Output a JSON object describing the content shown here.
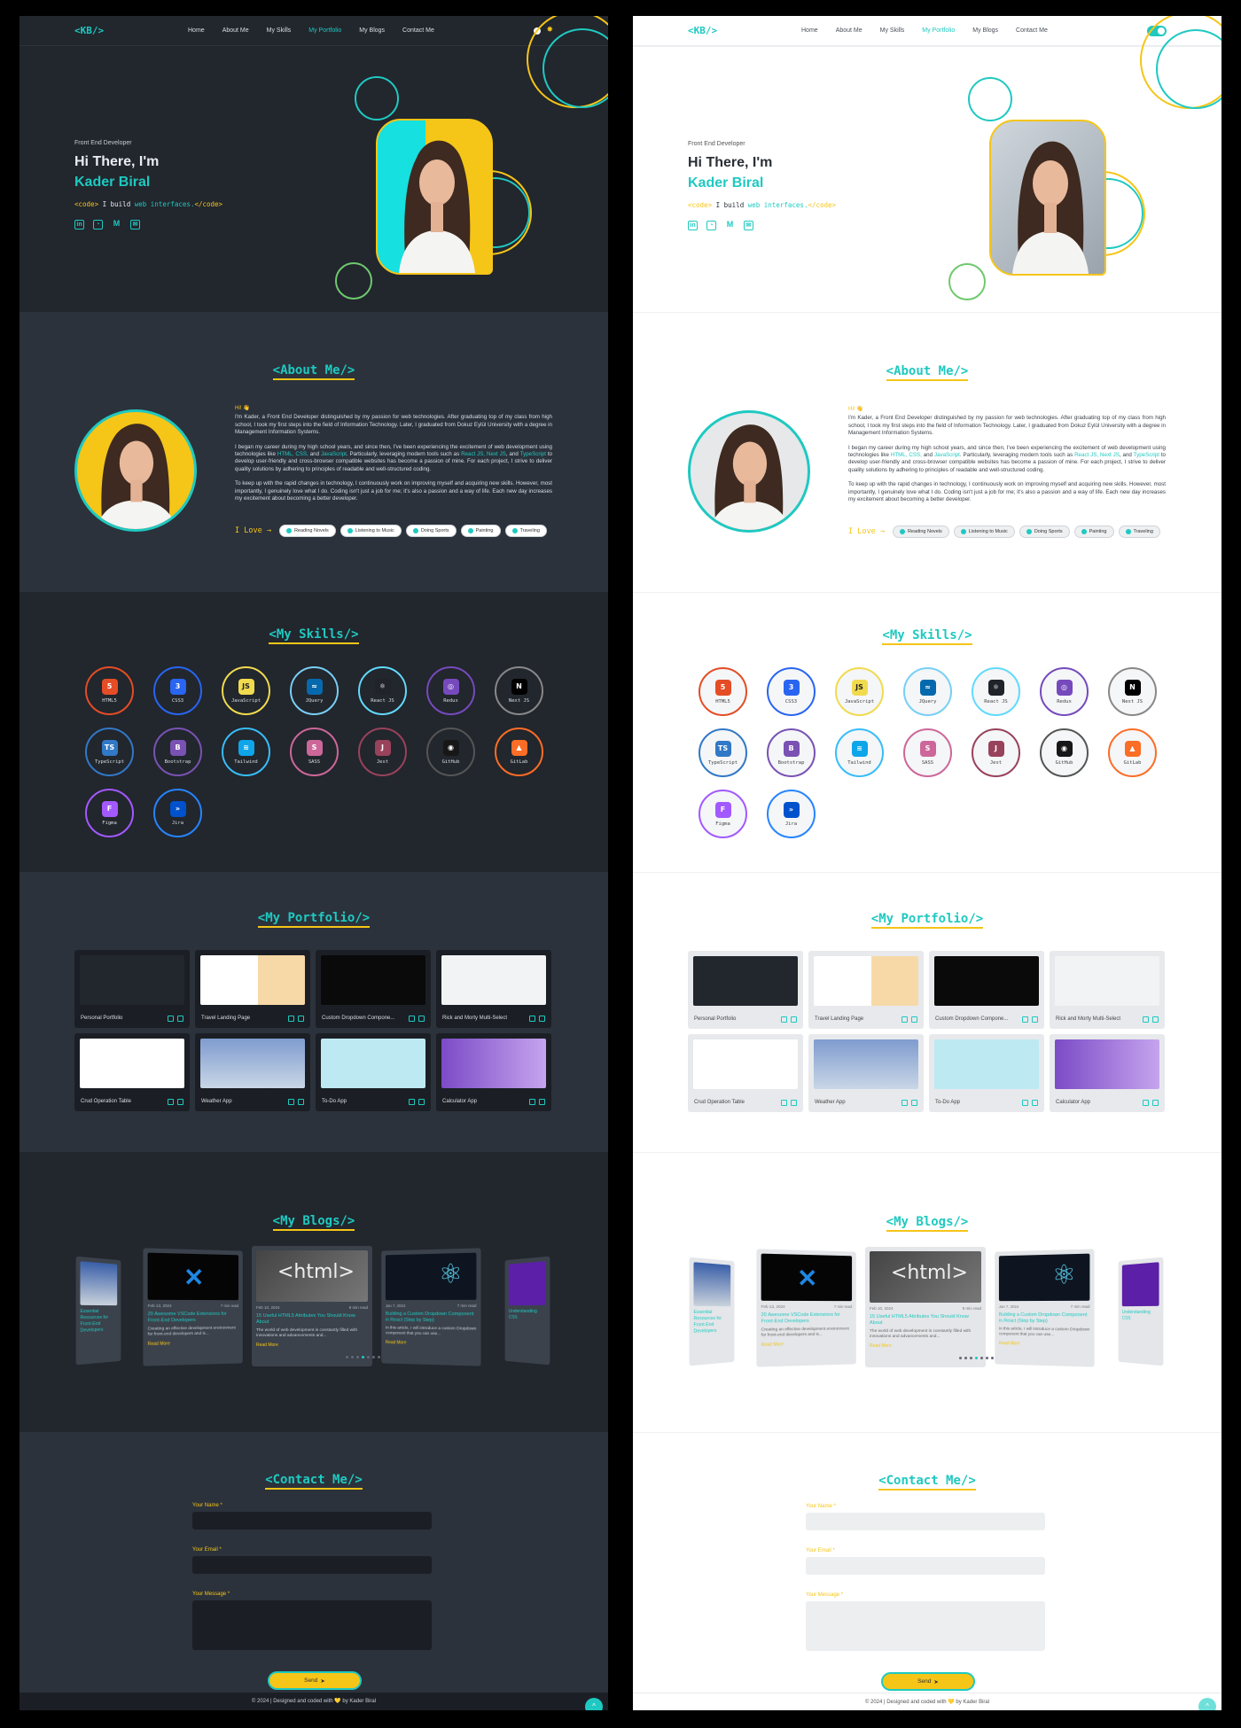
{
  "nav": {
    "logo": "<KB/>",
    "items": [
      "Home",
      "About Me",
      "My Skills",
      "My Portfolio",
      "My Blogs",
      "Contact Me"
    ],
    "active": "My Portfolio"
  },
  "hero": {
    "subtitle": "Front End Developer",
    "greeting": "Hi There, I'm",
    "name": "Kader Biral",
    "code_open": "<code>",
    "code_text": " I build ",
    "code_highlight": "web interfaces.",
    "code_close": "</code>",
    "socials": [
      "linkedin-icon",
      "github-icon",
      "medium-icon",
      "mail-icon"
    ]
  },
  "about": {
    "title": "<About Me/>",
    "hi": "Hi! 👋",
    "p1": "I'm Kader, a Front End Developer distinguished by my passion for web technologies. After graduating top of my class from high school, I took my first steps into the field of Information Technology. Later, I graduated from Dokuz Eylül University with a degree in Management Information Systems.",
    "p2a": "I began my career during my high school years, and since then, I've been experiencing the excitement of web development using technologies like ",
    "p2b": "HTML, CSS,",
    "p2c": " and ",
    "p2d": "JavaScript",
    "p2e": ". Particularly, leveraging modern tools such as ",
    "p2f": "React JS, Next JS",
    "p2g": ", and ",
    "p2h": "TypeScript",
    "p2i": " to develop user-friendly and cross-browser compatible websites has become a passion of mine. For each project, I strive to deliver quality solutions by adhering to principles of readable and well-structured coding.",
    "p3": "To keep up with the rapid changes in technology, I continuously work on improving myself and acquiring new skills. However, most importantly, I genuinely love what I do. Coding isn't just a job for me; it's also a passion and a way of life. Each new day increases my excitement about becoming a better developer.",
    "love_label": "I Love →",
    "loves": [
      "Reading Novels",
      "Listening to Music",
      "Doing Sports",
      "Painting",
      "Traveling"
    ]
  },
  "skills": {
    "title": "<My Skills/>",
    "items": [
      {
        "name": "HTML5",
        "glyph": "5",
        "color": "#e44d26",
        "bg": "#e44d26"
      },
      {
        "name": "CSS3",
        "glyph": "3",
        "color": "#2965f1",
        "bg": "#2965f1"
      },
      {
        "name": "JavaScript",
        "glyph": "JS",
        "color": "#f0db4f",
        "bg": "#f0db4f"
      },
      {
        "name": "JQuery",
        "glyph": "≈",
        "color": "#78cff5",
        "bg": "#0769ad"
      },
      {
        "name": "React JS",
        "glyph": "⚛",
        "color": "#61dafb",
        "bg": "#20232a"
      },
      {
        "name": "Redux",
        "glyph": "◎",
        "color": "#764abc",
        "bg": "#764abc"
      },
      {
        "name": "Next JS",
        "glyph": "N",
        "color": "#888888",
        "bg": "#000000"
      },
      {
        "name": "TypeScript",
        "glyph": "TS",
        "color": "#3178c6",
        "bg": "#3178c6"
      },
      {
        "name": "Bootstrap",
        "glyph": "B",
        "color": "#7952b3",
        "bg": "#7952b3"
      },
      {
        "name": "Tailwind",
        "glyph": "≋",
        "color": "#38bdf8",
        "bg": "#0ea5e9"
      },
      {
        "name": "SASS",
        "glyph": "S",
        "color": "#cd6799",
        "bg": "#cd6799"
      },
      {
        "name": "Jest",
        "glyph": "J",
        "color": "#99425b",
        "bg": "#99425b"
      },
      {
        "name": "GitHub",
        "glyph": "◉",
        "color": "#555555",
        "bg": "#181717"
      },
      {
        "name": "GitLab",
        "glyph": "▲",
        "color": "#fc6d26",
        "bg": "#fc6d26"
      },
      {
        "name": "Figma",
        "glyph": "F",
        "color": "#a259ff",
        "bg": "#a259ff"
      },
      {
        "name": "Jira",
        "glyph": "»",
        "color": "#2684ff",
        "bg": "#0052cc"
      }
    ]
  },
  "portfolio": {
    "title": "<My Portfolio/>",
    "items": [
      {
        "label": "Personal Portfolio",
        "thumb": "dark"
      },
      {
        "label": "Travel Landing Page",
        "thumb": "travel"
      },
      {
        "label": "Custom Dropdown Compone...",
        "thumb": "dropdown"
      },
      {
        "label": "Rick and Morty Multi-Select",
        "thumb": "rick"
      },
      {
        "label": "Crud Operation Table",
        "thumb": "crud"
      },
      {
        "label": "Weather App",
        "thumb": "weather"
      },
      {
        "label": "To-Do App",
        "thumb": "todo"
      },
      {
        "label": "Calculator App",
        "thumb": "calc"
      }
    ]
  },
  "blogs": {
    "title": "<My Blogs/>",
    "items": [
      {
        "date": "Feb 13, 2024",
        "read": "7 min read",
        "title": "20 Awesome VSCode Extensions for Front-End Developers",
        "desc": "Creating an effective development environment for front-end developers and is...",
        "more": "Read More",
        "img": "vscode"
      },
      {
        "date": "Feb 10, 2024",
        "read": "8 min read",
        "title": "15 Useful HTML5 Attributes You Should Know About",
        "desc": "The world of web development is constantly filled with innovations and advancements and...",
        "more": "Read More",
        "img": "html"
      },
      {
        "date": "Jan 7, 2024",
        "read": "7 min read",
        "title": "Building a Custom Dropdown Component in React (Step by Step)",
        "desc": "In this article, I will introduce a custom Dropdown component that you can use...",
        "more": "Read More",
        "img": "react"
      }
    ],
    "side_left_title": "Essential Resources for Front-End Developers",
    "side_right_title": "Understanding CSS"
  },
  "contact": {
    "title": "<Contact Me/>",
    "name_label": "Your Name *",
    "email_label": "Your Email *",
    "message_label": "Your Message *",
    "send": "Send"
  },
  "footer": {
    "text": "© 2024 | Designed and coded with 💛 by Kader Biral",
    "to_top": "^"
  },
  "colors": {
    "accent": "#1fc9c1",
    "highlight": "#f5c518"
  }
}
